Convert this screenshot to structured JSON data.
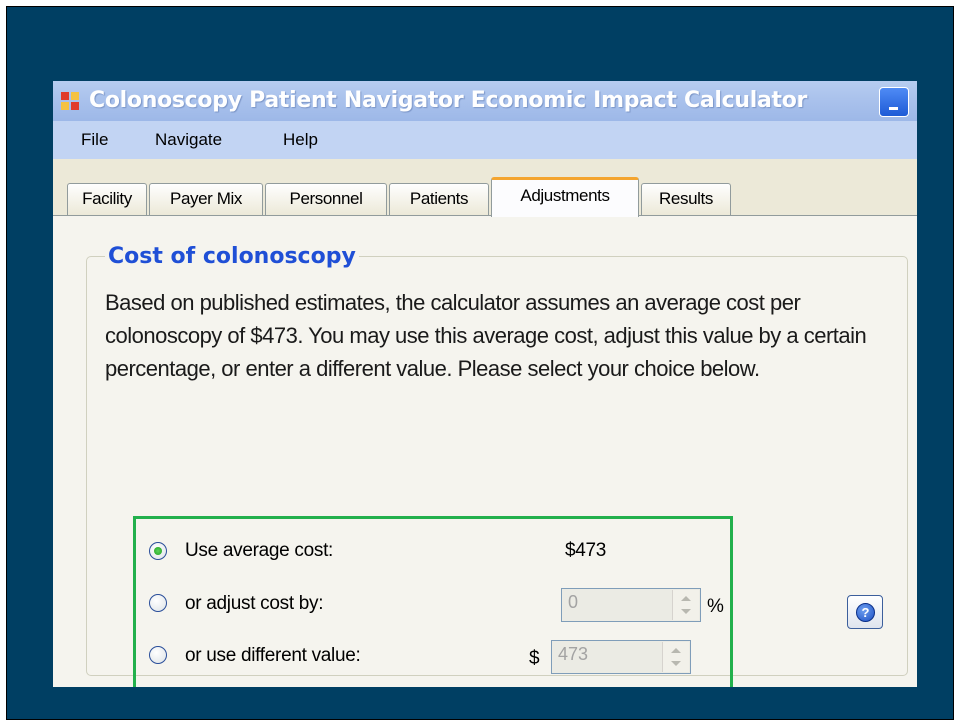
{
  "window": {
    "title": "Colonoscopy Patient Navigator Economic Impact Calculator"
  },
  "menu": {
    "items": [
      "File",
      "Navigate",
      "Help"
    ]
  },
  "tabs": {
    "items": [
      "Facility",
      "Payer Mix",
      "Personnel",
      "Patients",
      "Adjustments",
      "Results"
    ],
    "active": "Adjustments"
  },
  "group": {
    "title": "Cost of colonoscopy",
    "description": "Based on published estimates, the calculator assumes an average cost per colonoscopy of $473.  You may use this average cost, adjust this value by a certain percentage, or enter a different value.  Please select your choice below."
  },
  "options": {
    "average": {
      "label": "Use average cost:",
      "value": "$473",
      "selected": true
    },
    "adjust": {
      "label": "or adjust cost by:",
      "value": "0",
      "unit": "%",
      "selected": false
    },
    "different": {
      "label": "or use different value:",
      "currency": "$",
      "value": "473",
      "selected": false
    }
  },
  "help": {
    "icon": "help-icon",
    "glyph": "?"
  },
  "colors": {
    "background": "#003f63",
    "group_title": "#1f4fd6",
    "highlight_box": "#22b04c",
    "active_tab_accent": "#f4a52f"
  }
}
